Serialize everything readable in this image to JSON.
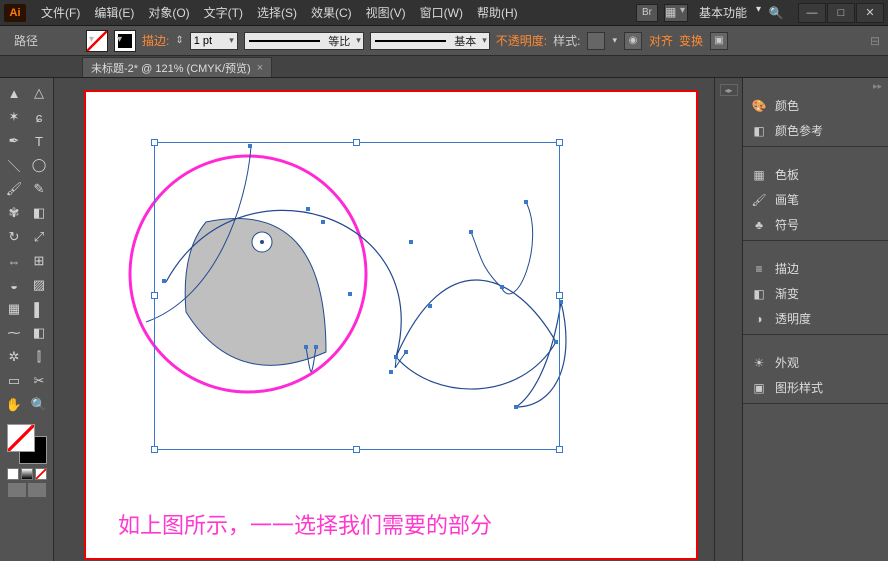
{
  "app": {
    "logo": "Ai"
  },
  "menu": {
    "file": "文件(F)",
    "edit": "编辑(E)",
    "object": "对象(O)",
    "type": "文字(T)",
    "select": "选择(S)",
    "effect": "效果(C)",
    "view": "视图(V)",
    "window": "窗口(W)",
    "help": "帮助(H)"
  },
  "workspace": {
    "label": "基本功能"
  },
  "optbar": {
    "context": "路径",
    "stroke_label": "描边:",
    "stroke_value": "1 pt",
    "profile1": "等比",
    "profile2": "基本",
    "opacity": "不透明度:",
    "style": "样式:",
    "align": "对齐",
    "transform": "变换"
  },
  "doc": {
    "tab": "未标题-2* @ 121% (CMYK/预览)"
  },
  "canvas": {
    "caption": "如上图所示，一一选择我们需要的部分"
  },
  "panels": {
    "color": "颜色",
    "color_guide": "颜色参考",
    "swatches": "色板",
    "brushes": "画笔",
    "symbols": "符号",
    "stroke": "描边",
    "gradient": "渐变",
    "transparency": "透明度",
    "appearance": "外观",
    "graphic_styles": "图形样式"
  }
}
